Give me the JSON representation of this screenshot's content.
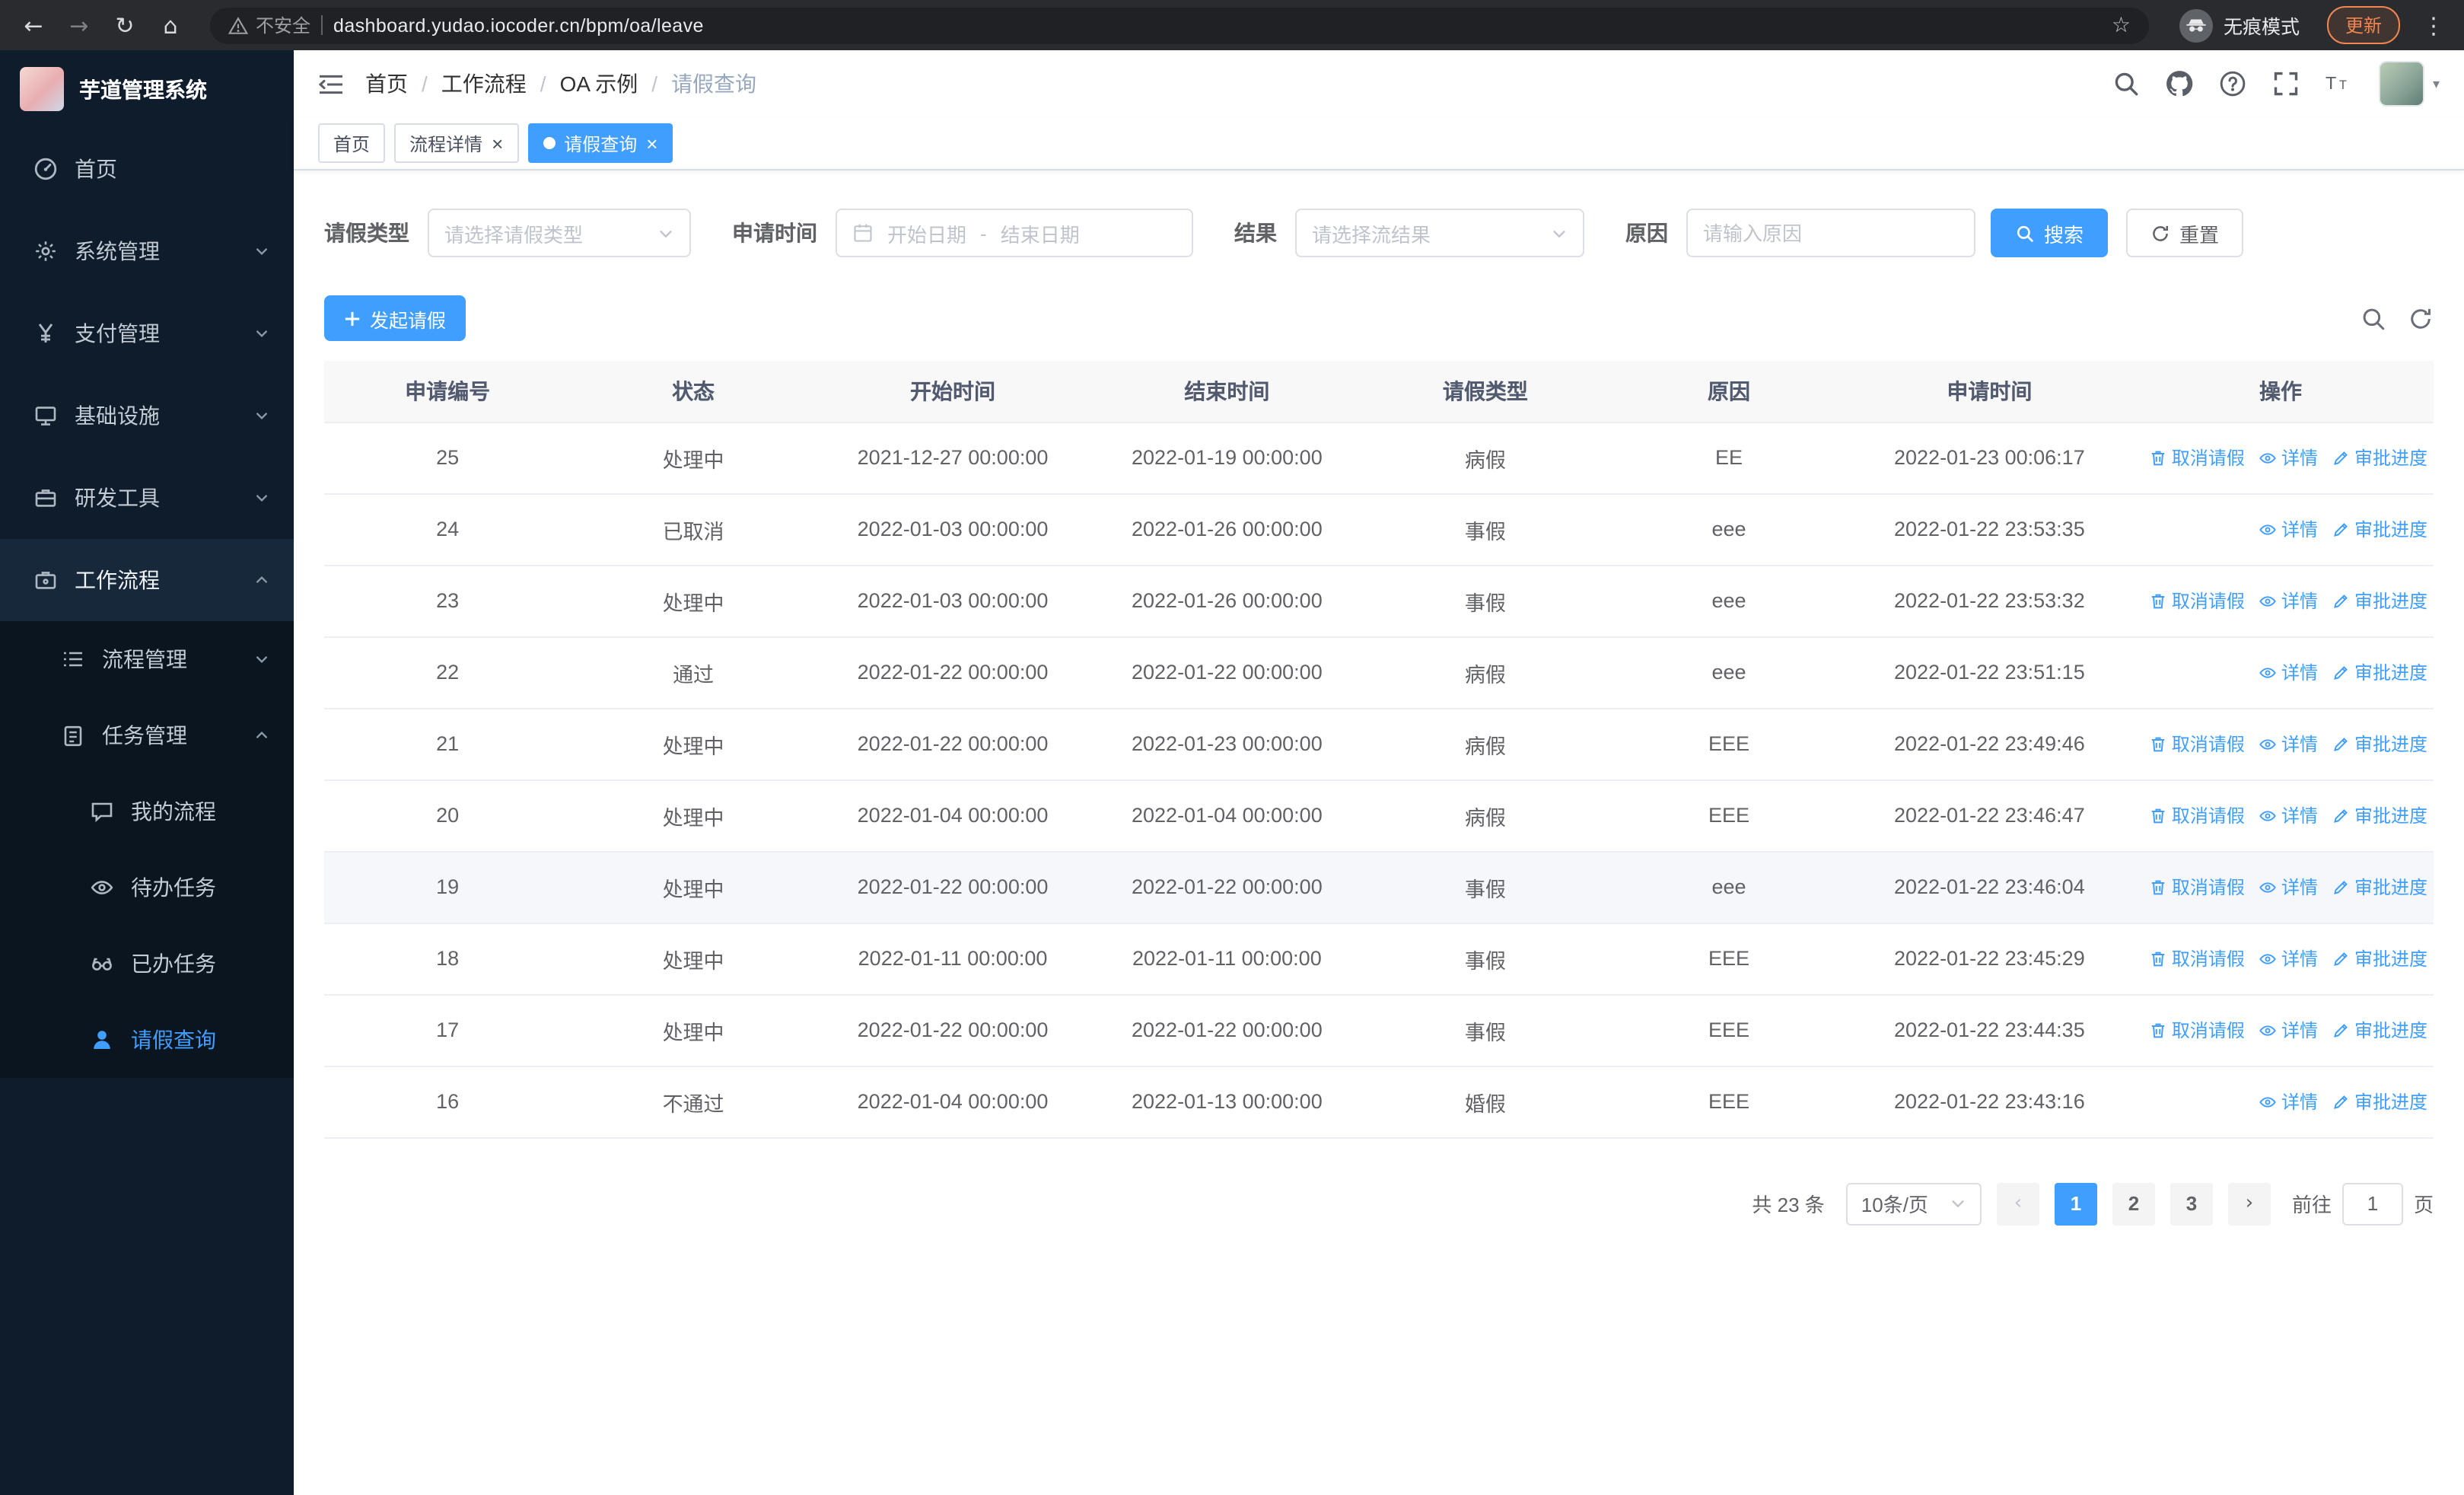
{
  "browser": {
    "security_label": "不安全",
    "url": "dashboard.yudao.iocoder.cn/bpm/oa/leave",
    "incognito_label": "无痕模式",
    "update_label": "更新"
  },
  "sidebar": {
    "logo_title": "芋道管理系统",
    "items": [
      {
        "label": "首页"
      },
      {
        "label": "系统管理"
      },
      {
        "label": "支付管理"
      },
      {
        "label": "基础设施"
      },
      {
        "label": "研发工具"
      },
      {
        "label": "工作流程"
      },
      {
        "label": "流程管理"
      },
      {
        "label": "任务管理"
      },
      {
        "label": "我的流程"
      },
      {
        "label": "待办任务"
      },
      {
        "label": "已办任务"
      },
      {
        "label": "请假查询"
      }
    ]
  },
  "breadcrumb": {
    "separator": "/",
    "items": [
      "首页",
      "工作流程",
      "OA 示例",
      "请假查询"
    ]
  },
  "tabs": [
    {
      "label": "首页"
    },
    {
      "label": "流程详情"
    },
    {
      "label": "请假查询"
    }
  ],
  "filters": {
    "leave_type_label": "请假类型",
    "leave_type_placeholder": "请选择请假类型",
    "apply_time_label": "申请时间",
    "start_placeholder": "开始日期",
    "range_separator": "-",
    "end_placeholder": "结束日期",
    "result_label": "结果",
    "result_placeholder": "请选择流结果",
    "reason_label": "原因",
    "reason_placeholder": "请输入原因",
    "search_label": "搜索",
    "reset_label": "重置"
  },
  "toolbar": {
    "create_label": "发起请假"
  },
  "table": {
    "columns": [
      "申请编号",
      "状态",
      "开始时间",
      "结束时间",
      "请假类型",
      "原因",
      "申请时间",
      "操作"
    ],
    "action_labels": {
      "cancel": "取消请假",
      "detail": "详情",
      "progress": "审批进度"
    },
    "rows": [
      {
        "id": "25",
        "status": "处理中",
        "start": "2021-12-27 00:00:00",
        "end": "2022-01-19 00:00:00",
        "type": "病假",
        "reason": "EE",
        "applied": "2022-01-23 00:06:17",
        "actions": [
          "cancel",
          "detail",
          "progress"
        ],
        "highlighted": false
      },
      {
        "id": "24",
        "status": "已取消",
        "start": "2022-01-03 00:00:00",
        "end": "2022-01-26 00:00:00",
        "type": "事假",
        "reason": "eee",
        "applied": "2022-01-22 23:53:35",
        "actions": [
          "detail",
          "progress"
        ],
        "highlighted": false
      },
      {
        "id": "23",
        "status": "处理中",
        "start": "2022-01-03 00:00:00",
        "end": "2022-01-26 00:00:00",
        "type": "事假",
        "reason": "eee",
        "applied": "2022-01-22 23:53:32",
        "actions": [
          "cancel",
          "detail",
          "progress"
        ],
        "highlighted": false
      },
      {
        "id": "22",
        "status": "通过",
        "start": "2022-01-22 00:00:00",
        "end": "2022-01-22 00:00:00",
        "type": "病假",
        "reason": "eee",
        "applied": "2022-01-22 23:51:15",
        "actions": [
          "detail",
          "progress"
        ],
        "highlighted": false
      },
      {
        "id": "21",
        "status": "处理中",
        "start": "2022-01-22 00:00:00",
        "end": "2022-01-23 00:00:00",
        "type": "病假",
        "reason": "EEE",
        "applied": "2022-01-22 23:49:46",
        "actions": [
          "cancel",
          "detail",
          "progress"
        ],
        "highlighted": false
      },
      {
        "id": "20",
        "status": "处理中",
        "start": "2022-01-04 00:00:00",
        "end": "2022-01-04 00:00:00",
        "type": "病假",
        "reason": "EEE",
        "applied": "2022-01-22 23:46:47",
        "actions": [
          "cancel",
          "detail",
          "progress"
        ],
        "highlighted": false
      },
      {
        "id": "19",
        "status": "处理中",
        "start": "2022-01-22 00:00:00",
        "end": "2022-01-22 00:00:00",
        "type": "事假",
        "reason": "eee",
        "applied": "2022-01-22 23:46:04",
        "actions": [
          "cancel",
          "detail",
          "progress"
        ],
        "highlighted": true
      },
      {
        "id": "18",
        "status": "处理中",
        "start": "2022-01-11 00:00:00",
        "end": "2022-01-11 00:00:00",
        "type": "事假",
        "reason": "EEE",
        "applied": "2022-01-22 23:45:29",
        "actions": [
          "cancel",
          "detail",
          "progress"
        ],
        "highlighted": false
      },
      {
        "id": "17",
        "status": "处理中",
        "start": "2022-01-22 00:00:00",
        "end": "2022-01-22 00:00:00",
        "type": "事假",
        "reason": "EEE",
        "applied": "2022-01-22 23:44:35",
        "actions": [
          "cancel",
          "detail",
          "progress"
        ],
        "highlighted": false
      },
      {
        "id": "16",
        "status": "不通过",
        "start": "2022-01-04 00:00:00",
        "end": "2022-01-13 00:00:00",
        "type": "婚假",
        "reason": "EEE",
        "applied": "2022-01-22 23:43:16",
        "actions": [
          "detail",
          "progress"
        ],
        "highlighted": false
      }
    ]
  },
  "pagination": {
    "total_label": "共 23 条",
    "page_size_label": "10条/页",
    "pages": [
      "1",
      "2",
      "3"
    ],
    "active_page": "1",
    "goto_prefix": "前往",
    "goto_value": "1",
    "goto_suffix": "页"
  },
  "colors": {
    "primary": "#409eff",
    "sidebar_bg": "#0e1c2b",
    "chrome_bg": "#2a2b2e"
  }
}
